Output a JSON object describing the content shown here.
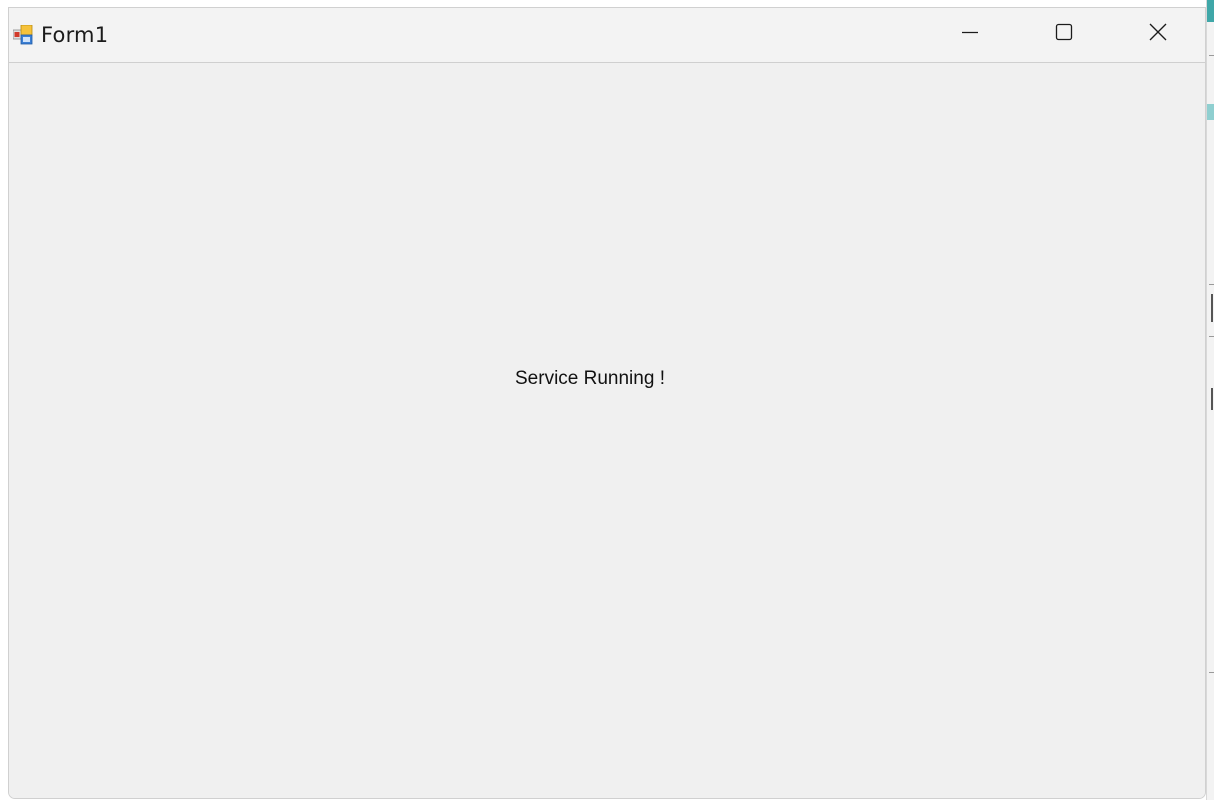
{
  "window": {
    "title": "Form1",
    "icon": "winforms-app-icon",
    "caption_buttons": [
      {
        "name": "minimize",
        "icon": "minimize-icon"
      },
      {
        "name": "maximize",
        "icon": "maximize-icon"
      },
      {
        "name": "close",
        "icon": "close-icon"
      }
    ]
  },
  "form": {
    "status_label": "Service Running !"
  },
  "colors": {
    "titlebar": "#f3f3f3",
    "client_background": "#f0f0f0",
    "text": "#111111"
  }
}
